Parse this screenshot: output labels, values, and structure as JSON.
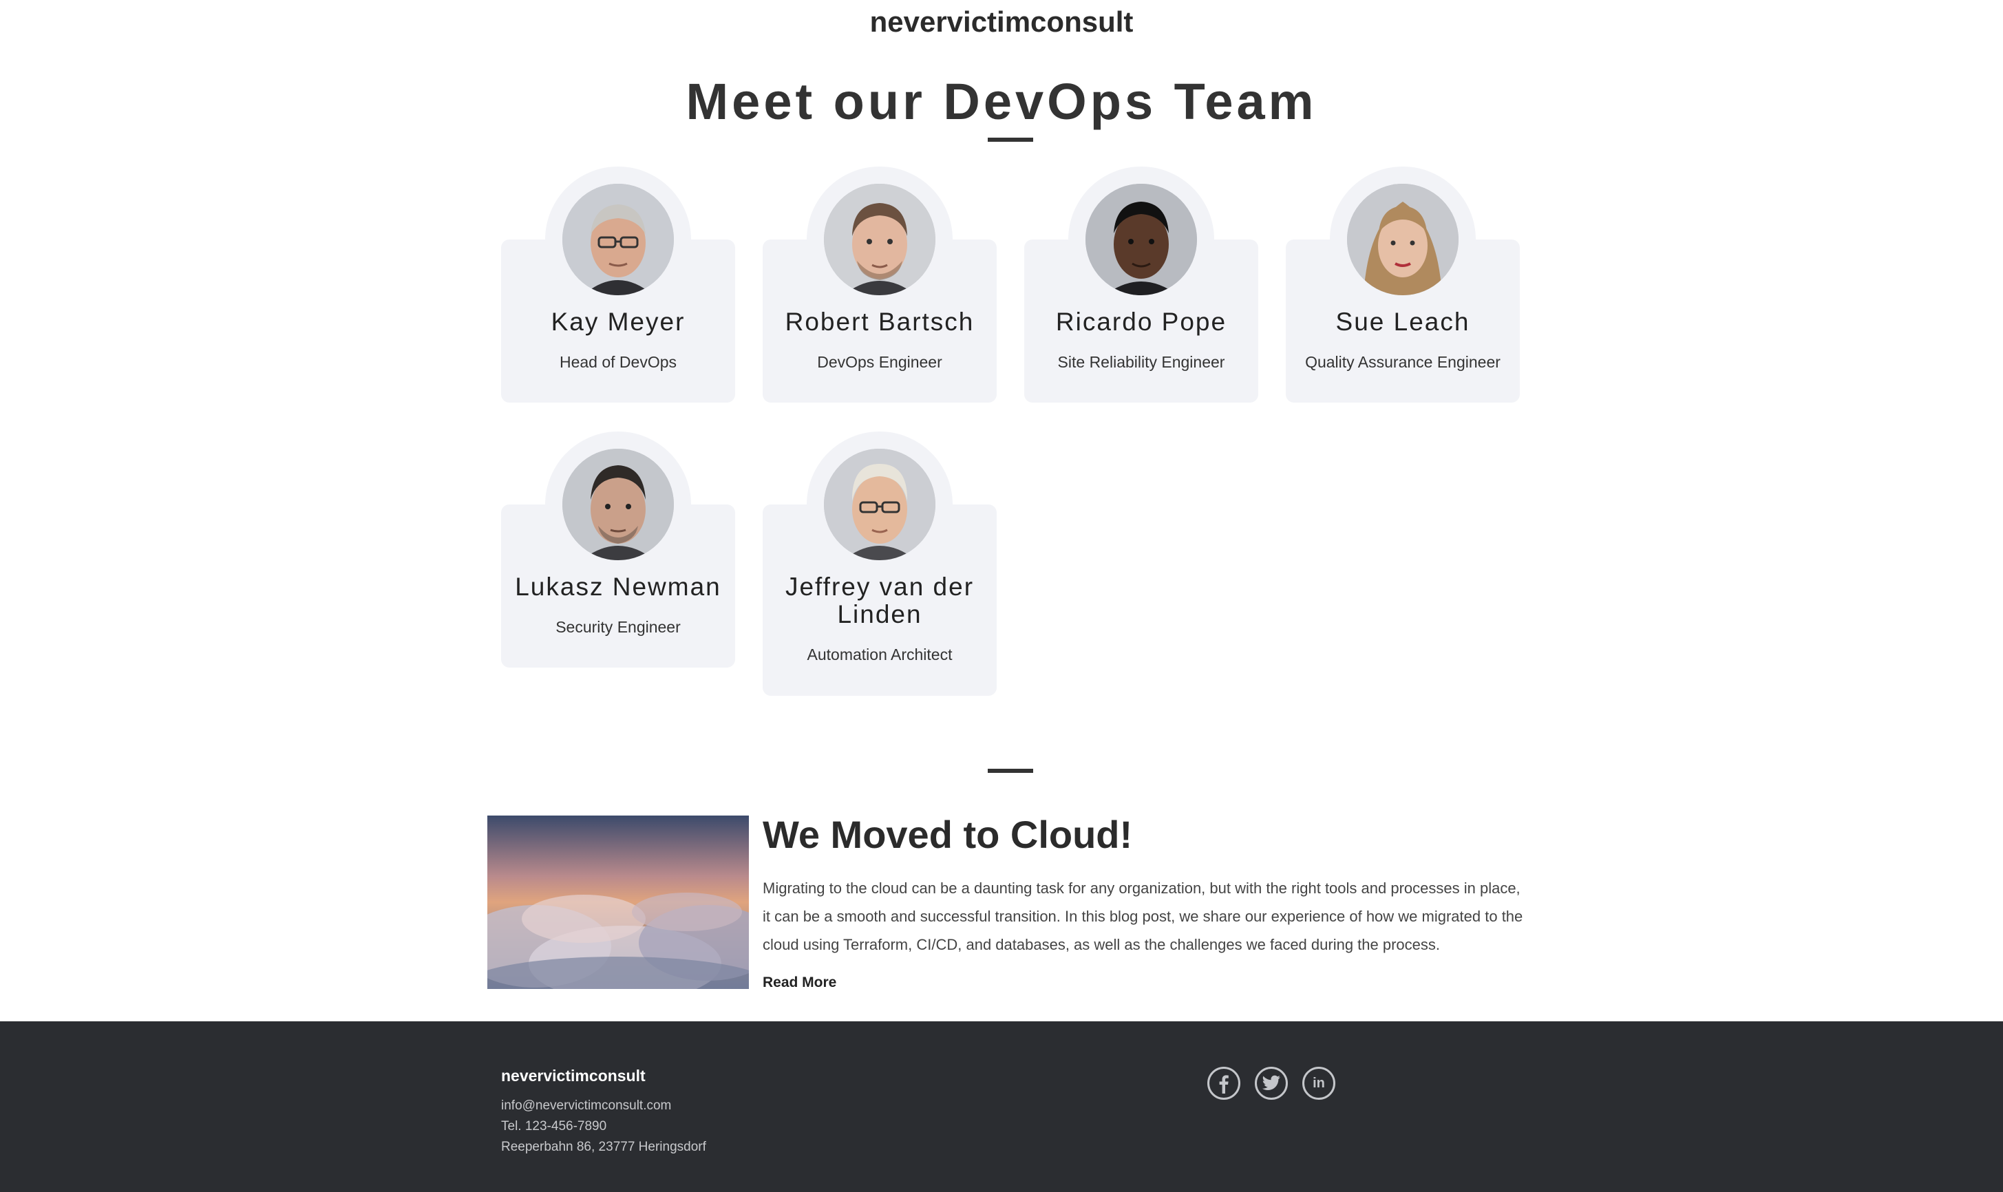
{
  "brand": "nevervictimconsult",
  "team": {
    "title": "Meet our DevOps Team",
    "members": [
      {
        "name": "Kay Meyer",
        "role": "Head of DevOps"
      },
      {
        "name": "Robert Bartsch",
        "role": "DevOps Engineer"
      },
      {
        "name": "Ricardo Pope",
        "role": "Site Reliability Engineer"
      },
      {
        "name": "Sue Leach",
        "role": "Quality Assurance Engineer"
      },
      {
        "name": "Lukasz Newman",
        "role": "Security Engineer"
      },
      {
        "name": "Jeffrey van der Linden",
        "role": "Automation Architect"
      }
    ]
  },
  "post": {
    "title": "We Moved to Cloud!",
    "body": "Migrating to the cloud can be a daunting task for any organization, but with the right tools and processes in place, it can be a smooth and successful transition. In this blog post, we share our experience of how we migrated to the cloud using Terraform, CI/CD, and databases, as well as the challenges we faced during the process.",
    "read_more": "Read More"
  },
  "footer": {
    "brand": "nevervictimconsult",
    "email": "info@nevervictimconsult.com",
    "phone": "Tel. 123-456-7890",
    "address": "Reeperbahn 86, 23777 Heringsdorf",
    "social": [
      "facebook-icon",
      "twitter-icon",
      "linkedin-icon"
    ]
  },
  "colors": {
    "card_bg": "#f2f3f7",
    "footer_bg": "#2b2d31",
    "text_dark": "#333333"
  }
}
